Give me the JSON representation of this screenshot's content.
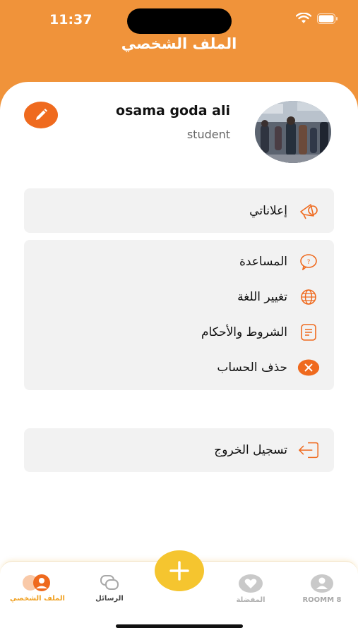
{
  "status_bar": {
    "time": "11:37"
  },
  "header": {
    "title": "الملف الشخصي"
  },
  "profile": {
    "name": "osama goda ali",
    "role": "student"
  },
  "menu": {
    "ads": "إعلاناتي",
    "help": "المساعدة",
    "language": "تغيير اللغة",
    "terms": "الشروط والأحكام",
    "delete_account": "حذف الحساب",
    "logout": "تسجيل الخروج"
  },
  "tabs": [
    {
      "label": "الملف الشخصي",
      "icon": "profile-icon",
      "active": true
    },
    {
      "label": "الرسائل",
      "icon": "chat-icon",
      "active": false
    },
    {
      "label": "المفضلة",
      "icon": "heart-icon",
      "active": false
    },
    {
      "label": "ROOMM 8",
      "icon": "user-icon",
      "active": false
    }
  ],
  "colors": {
    "header": "#f0933a",
    "accent": "#ef6a1e",
    "fab": "#f5c52f",
    "active_tab": "#f0a020",
    "inactive_tab": "#a8a8a8"
  }
}
